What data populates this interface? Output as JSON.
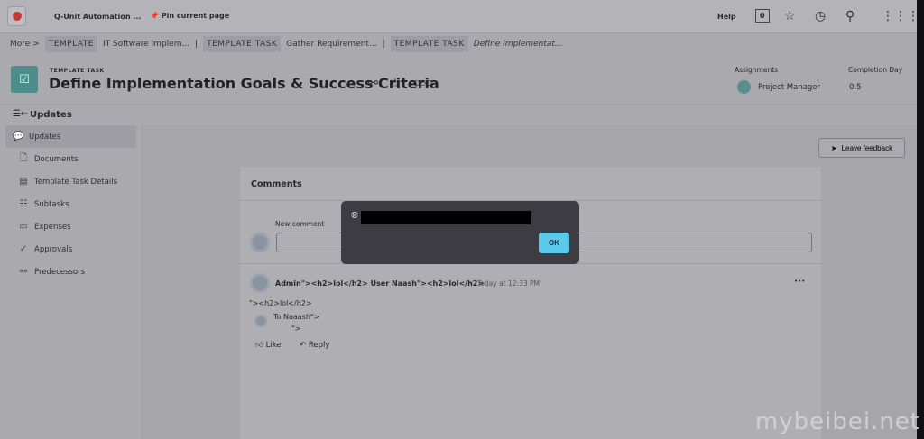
{
  "topbar": {
    "workspace": "Q-Unit Automation ...",
    "pin": "Pin current page",
    "help": "Help",
    "badge": "0"
  },
  "breadcrumb": {
    "more": "More >",
    "items": [
      {
        "tag": "TEMPLATE",
        "label": "IT Software Implem..."
      },
      {
        "tag": "TEMPLATE TASK",
        "label": "Gather Requirement..."
      },
      {
        "tag": "TEMPLATE TASK",
        "label": "Define Implementat..."
      }
    ],
    "sep": "|"
  },
  "header": {
    "type": "TEMPLATE TASK",
    "title": "Define Implementation Goals & Success Criteria",
    "assignments_label": "Assignments",
    "assignee": "Project Manager",
    "completion_label": "Completion Day",
    "completion": "0.5"
  },
  "updates_heading": "Updates",
  "sidebar": {
    "items": [
      {
        "label": "Updates",
        "icon": "chat-icon"
      },
      {
        "label": "Documents",
        "icon": "document-icon"
      },
      {
        "label": "Template Task Details",
        "icon": "details-icon"
      },
      {
        "label": "Subtasks",
        "icon": "subtasks-icon"
      },
      {
        "label": "Expenses",
        "icon": "expenses-icon"
      },
      {
        "label": "Approvals",
        "icon": "approvals-icon"
      },
      {
        "label": "Predecessors",
        "icon": "predecessors-icon"
      }
    ]
  },
  "feedback": "Leave feedback",
  "comments": {
    "title": "Comments",
    "new_label": "New comment",
    "author": "Admin\"><h2>lol</h2> User Naash\"><h2>lol</h2>",
    "dot": "·",
    "time": "Today at 12:33 PM",
    "body": "\"><h2>lol</h2>",
    "to": "To Naaash\">",
    "to2": "\">",
    "like": "Like",
    "reply": "Reply",
    "more": "•••"
  },
  "dialog": {
    "ok": "OK"
  },
  "watermark": "mybeibei.net"
}
